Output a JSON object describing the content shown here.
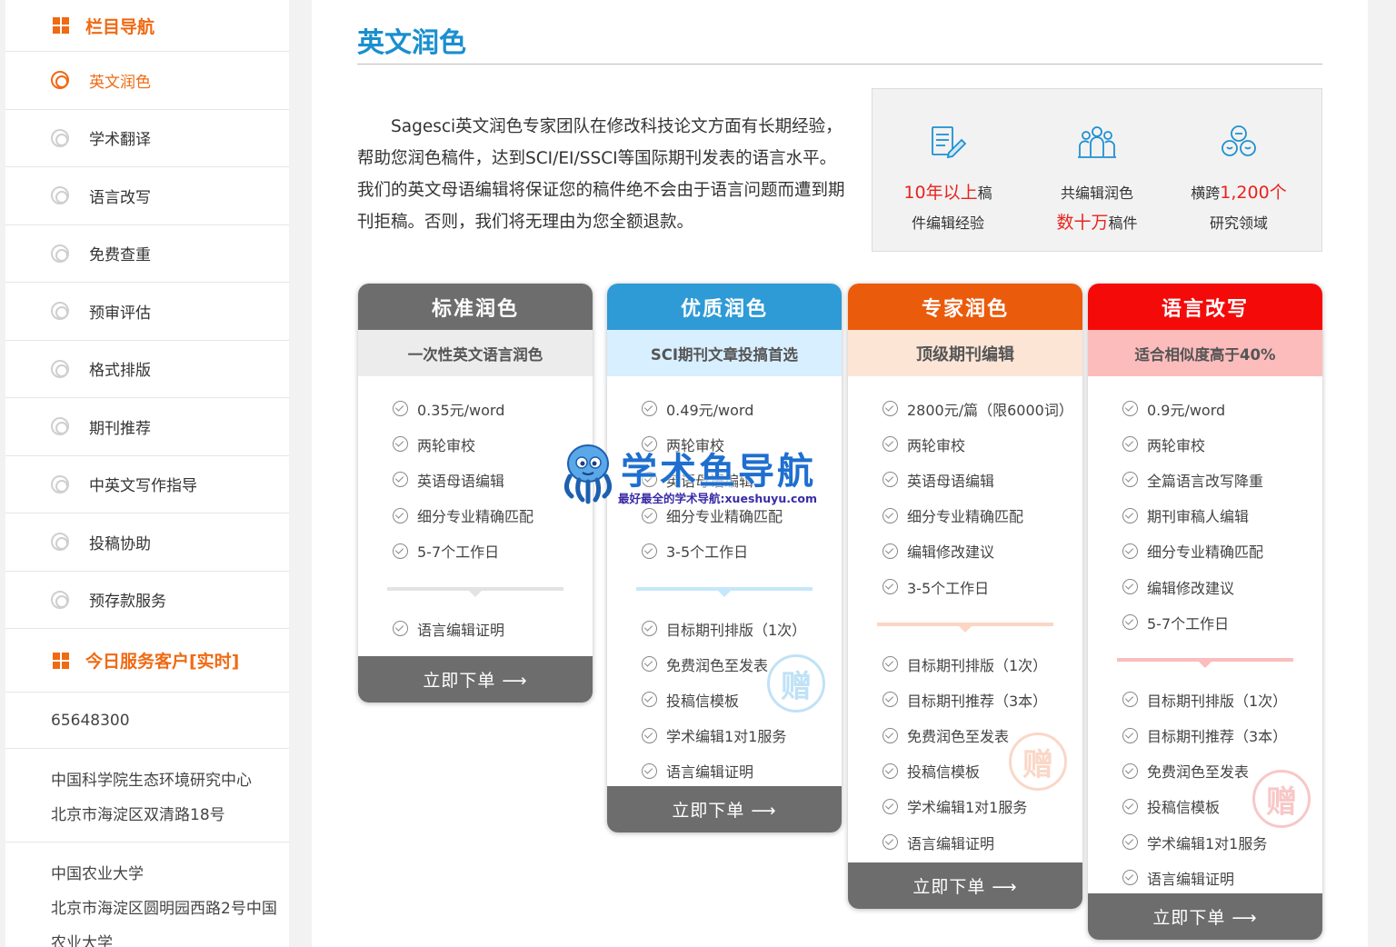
{
  "sidebar": {
    "nav_title": "栏目导航",
    "items": [
      {
        "label": "英文润色"
      },
      {
        "label": "学术翻译"
      },
      {
        "label": "语言改写"
      },
      {
        "label": "免费查重"
      },
      {
        "label": "预审评估"
      },
      {
        "label": "格式排版"
      },
      {
        "label": "期刊推荐"
      },
      {
        "label": "中英文写作指导"
      },
      {
        "label": "投稿协助"
      },
      {
        "label": "预存款服务"
      }
    ],
    "clients_title": "今日服务客户[实时]",
    "client_count": "65648300",
    "clients": [
      {
        "line1": "中国科学院生态环境研究中心",
        "line2": "北京市海淀区双清路18号"
      },
      {
        "line1": "中国农业大学",
        "line2": "北京市海淀区圆明园西路2号中国",
        "line3": "农业大学"
      }
    ]
  },
  "main": {
    "title": "英文润色",
    "intro": "Sagesci英文润色专家团队在修改科技论文方面有长期经验，帮助您润色稿件，达到SCI/EI/SSCI等国际期刊发表的语言水平。我们的英文母语编辑将保证您的稿件绝不会由于语言问题而遭到期刊拒稿。否则，我们将无理由为您全额退款。"
  },
  "stats": [
    {
      "icon": "document-edit-icon",
      "big": "10年以上",
      "rest1": "稿",
      "line2": "件编辑经验"
    },
    {
      "icon": "team-icon",
      "line1": "共编辑润色",
      "big": "数十万",
      "rest2": "稿件"
    },
    {
      "icon": "globe-people-icon",
      "pre1": "横跨",
      "big": "1,200个",
      "line2": "研究领域"
    }
  ],
  "plans": [
    {
      "name": "标准润色",
      "subtitle": "一次性英文语言润色",
      "features": [
        "0.35元/word",
        "两轮审校",
        "英语母语编辑",
        "细分专业精确匹配",
        "5-7个工作日"
      ],
      "extras": [
        "语言编辑证明"
      ],
      "order": "立即下单 ⟶"
    },
    {
      "name": "优质润色",
      "subtitle": "SCI期刊文章投搞首选",
      "features": [
        "0.49元/word",
        "两轮审校",
        "英语母语编辑",
        "细分专业精确匹配",
        "3-5个工作日"
      ],
      "extras": [
        "目标期刊排版（1次）",
        "免费润色至发表",
        "投稿信模板",
        "学术编辑1对1服务",
        "语言编辑证明"
      ],
      "stamp": "赠",
      "order": "立即下单 ⟶"
    },
    {
      "name": "专家润色",
      "subtitle": "顶级期刊编辑",
      "features": [
        "2800元/篇（限6000词）",
        "两轮审校",
        "英语母语编辑",
        "细分专业精确匹配",
        "编辑修改建议",
        "3-5个工作日"
      ],
      "extras": [
        "目标期刊排版（1次）",
        "目标期刊推荐（3本）",
        "免费润色至发表",
        "投稿信模板",
        "学术编辑1对1服务",
        "语言编辑证明"
      ],
      "stamp": "赠",
      "order": "立即下单 ⟶"
    },
    {
      "name": "语言改写",
      "subtitle": "适合相似度高于40%",
      "features": [
        "0.9元/word",
        "两轮审校",
        "全篇语言改写降重",
        "期刊审稿人编辑",
        "细分专业精确匹配",
        "编辑修改建议",
        "5-7个工作日"
      ],
      "extras": [
        "目标期刊排版（1次）",
        "目标期刊推荐（3本）",
        "免费润色至发表",
        "投稿信模板",
        "学术编辑1对1服务",
        "语言编辑证明"
      ],
      "stamp": "赠",
      "order": "立即下单 ⟶"
    }
  ],
  "watermark": {
    "title": "学术鱼导航",
    "subtitle": "最好最全的学术导航:xueshuyu.com"
  },
  "colors": {
    "accent": "#f06a13",
    "title_blue": "#1a8fcf",
    "standard": "#6d6d6d",
    "premium": "#2e9ad6",
    "expert": "#ea5b0c",
    "rewrite": "#f50a0a"
  }
}
